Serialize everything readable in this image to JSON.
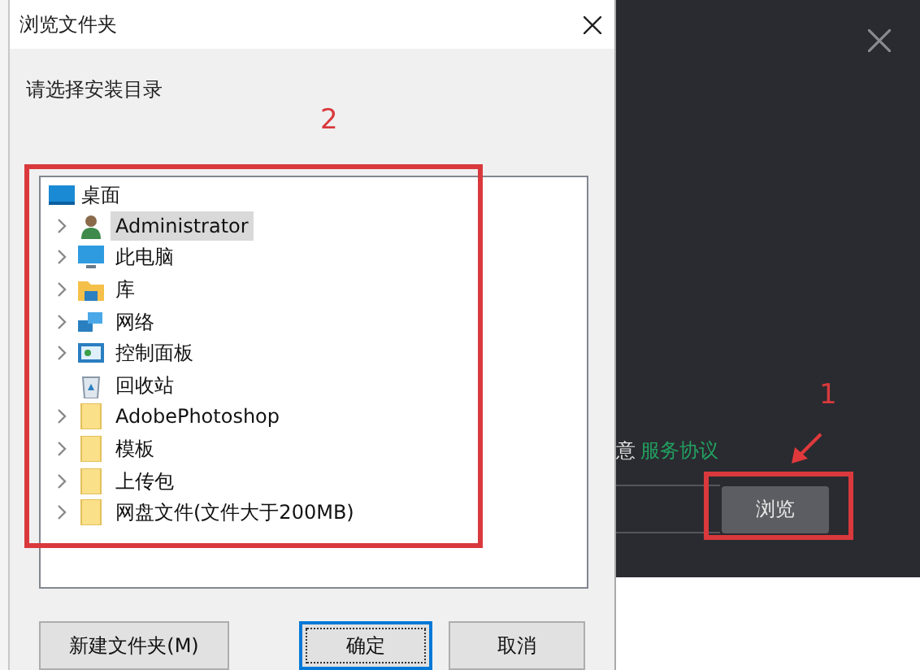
{
  "dialog": {
    "title": "浏览文件夹",
    "prompt": "请选择安装目录",
    "tree": {
      "label": "桌面",
      "kind": "desktop",
      "children": [
        {
          "label": "Administrator",
          "kind": "user",
          "expandable": true,
          "selected": true
        },
        {
          "label": "此电脑",
          "kind": "computer",
          "expandable": true,
          "selected": false
        },
        {
          "label": "库",
          "kind": "library",
          "expandable": true,
          "selected": false
        },
        {
          "label": "网络",
          "kind": "network",
          "expandable": true,
          "selected": false
        },
        {
          "label": "控制面板",
          "kind": "control",
          "expandable": true,
          "selected": false
        },
        {
          "label": "回收站",
          "kind": "recycle",
          "expandable": false,
          "selected": false
        },
        {
          "label": "AdobePhotoshop",
          "kind": "folder",
          "expandable": true,
          "selected": false
        },
        {
          "label": "模板",
          "kind": "folder",
          "expandable": true,
          "selected": false
        },
        {
          "label": "上传包",
          "kind": "folder",
          "expandable": true,
          "selected": false
        },
        {
          "label": "网盘文件(文件大于200MB)",
          "kind": "folder",
          "expandable": true,
          "selected": false
        }
      ]
    },
    "buttons": [
      {
        "label": "新建文件夹(M)",
        "focused": false
      },
      {
        "label": "确定",
        "focused": true
      },
      {
        "label": "取消",
        "focused": false
      }
    ]
  },
  "installer": {
    "agree_text": "意",
    "agreement_link": "服务协议",
    "browse_button": "浏览"
  },
  "annotations": [
    {
      "label": "2"
    },
    {
      "label": "1"
    }
  ]
}
